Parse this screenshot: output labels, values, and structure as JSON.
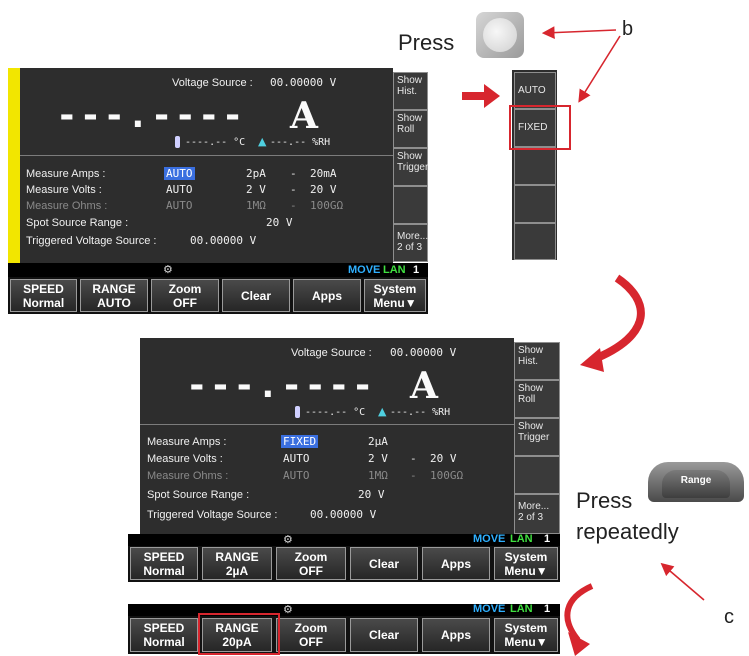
{
  "callouts": {
    "press1": "Press",
    "b": "b",
    "press2": "Press",
    "repeatedly": "repeatedly",
    "c": "c"
  },
  "range_key_label": "Range",
  "panel1": {
    "vsrc_label": "Voltage Source :",
    "vsrc_value": "00.00000  V",
    "reading": "---.----",
    "unit": "A",
    "temp": "----.-- °C",
    "rh": "---.-- %RH",
    "rows": [
      {
        "label": "Measure Amps :",
        "v1": "AUTO",
        "v2": "2pA",
        "dash": "-",
        "v3": "20mA"
      },
      {
        "label": "Measure Volts :",
        "v1": "AUTO",
        "v2": "2 V",
        "dash": "-",
        "v3": "20 V"
      },
      {
        "label": "Measure Ohms :",
        "v1": "AUTO",
        "v2": "1MΩ",
        "dash": "-",
        "v3": "100GΩ"
      }
    ],
    "spot_label": "Spot Source Range :",
    "spot_value": "20  V",
    "trig_label": "Triggered Voltage Source :",
    "trig_value": "00.00000  V",
    "side": [
      "Show Hist.",
      "Show Roll",
      "Show Trigger",
      "",
      "More... 2 of 3"
    ],
    "status": {
      "move": "MOVE",
      "lan": "LAN",
      "num": "1"
    },
    "softkeys": [
      {
        "l1": "SPEED",
        "l2": "Normal"
      },
      {
        "l1": "RANGE",
        "l2": "AUTO"
      },
      {
        "l1": "Zoom",
        "l2": "OFF"
      },
      {
        "l1": "Clear",
        "l2": ""
      },
      {
        "l1": "Apps",
        "l2": ""
      },
      {
        "l1": "System",
        "l2": "Menu▼"
      }
    ]
  },
  "menu_popup": {
    "items": [
      "AUTO",
      "FIXED",
      "",
      "",
      ""
    ]
  },
  "panel2": {
    "vsrc_label": "Voltage Source :",
    "vsrc_value": "00.00000  V",
    "reading": "---.----",
    "unit": "A",
    "temp": "----.-- °C",
    "rh": "---.-- %RH",
    "rows": [
      {
        "label": "Measure Amps :",
        "v1": "FIXED",
        "v2": "2µA",
        "dash": "",
        "v3": ""
      },
      {
        "label": "Measure Volts :",
        "v1": "AUTO",
        "v2": "2 V",
        "dash": "-",
        "v3": "20 V"
      },
      {
        "label": "Measure Ohms :",
        "v1": "AUTO",
        "v2": "1MΩ",
        "dash": "-",
        "v3": "100GΩ"
      }
    ],
    "spot_label": "Spot Source Range :",
    "spot_value": "20  V",
    "trig_label": "Triggered Voltage Source :",
    "trig_value": "00.00000  V",
    "side": [
      "Show Hist.",
      "Show Roll",
      "Show Trigger",
      "",
      "More... 2 of 3"
    ],
    "status": {
      "move": "MOVE",
      "lan": "LAN",
      "num": "1"
    },
    "softkeys": [
      {
        "l1": "SPEED",
        "l2": "Normal"
      },
      {
        "l1": "RANGE",
        "l2": "2µA"
      },
      {
        "l1": "Zoom",
        "l2": "OFF"
      },
      {
        "l1": "Clear",
        "l2": ""
      },
      {
        "l1": "Apps",
        "l2": ""
      },
      {
        "l1": "System",
        "l2": "Menu▼"
      }
    ]
  },
  "panel3": {
    "status": {
      "move": "MOVE",
      "lan": "LAN",
      "num": "1"
    },
    "softkeys": [
      {
        "l1": "SPEED",
        "l2": "Normal"
      },
      {
        "l1": "RANGE",
        "l2": "20pA"
      },
      {
        "l1": "Zoom",
        "l2": "OFF"
      },
      {
        "l1": "Clear",
        "l2": ""
      },
      {
        "l1": "Apps",
        "l2": ""
      },
      {
        "l1": "System",
        "l2": "Menu▼"
      }
    ]
  },
  "colors": {
    "arrow": "#d7262e",
    "highlight_box": "#d7262e",
    "yellow_bar": "#f2e600",
    "selection": "#3a6fe0"
  }
}
